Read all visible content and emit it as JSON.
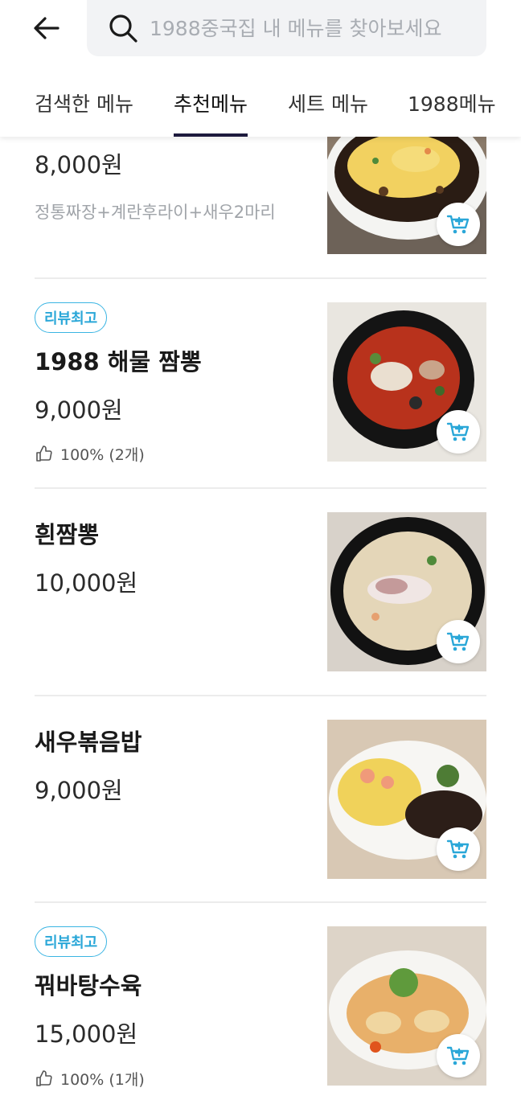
{
  "search": {
    "placeholder": "1988중국집 내 메뉴를 찾아보세요"
  },
  "tabs": [
    {
      "label": "검색한 메뉴",
      "active": false
    },
    {
      "label": "추천메뉴",
      "active": true
    },
    {
      "label": "세트 메뉴",
      "active": false
    },
    {
      "label": "1988메뉴",
      "active": false
    }
  ],
  "menu": [
    {
      "price": "8,000원",
      "desc": "정통짜장+계란후라이+새우2마리"
    },
    {
      "badge": "리뷰최고",
      "name": "1988 해물 짬뽕",
      "price": "9,000원",
      "review": "100% (2개)"
    },
    {
      "name": "흰짬뽕",
      "price": "10,000원"
    },
    {
      "name": "새우볶음밥",
      "price": "9,000원"
    },
    {
      "badge": "리뷰최고",
      "name": "꿔바탕수육",
      "price": "15,000원",
      "review": "100% (1개)"
    }
  ],
  "colors": {
    "accent": "#2aa7d8",
    "tab_underline": "#1d1a3d"
  }
}
